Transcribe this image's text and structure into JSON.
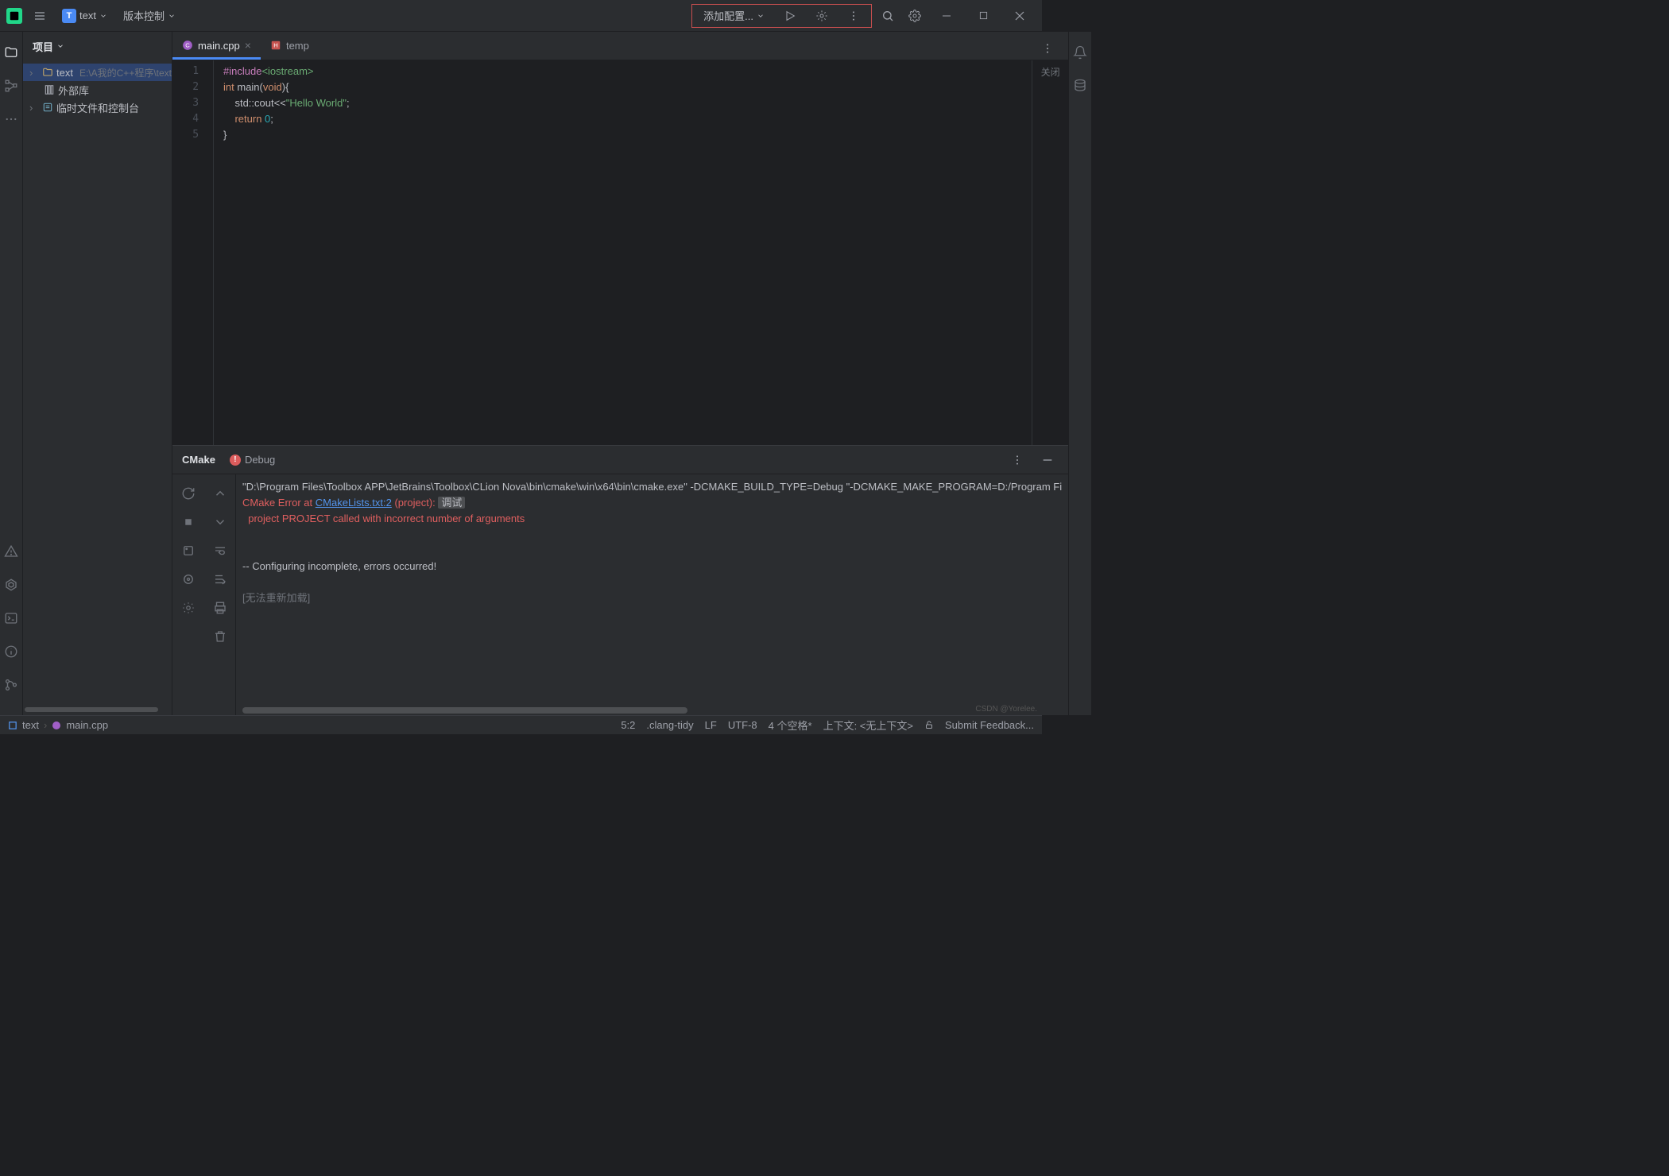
{
  "titlebar": {
    "project_badge": "T",
    "project_name": "text",
    "vcs_label": "版本控制",
    "run_config": "添加配置..."
  },
  "project_panel": {
    "title": "项目",
    "items": [
      {
        "label": "text",
        "path": "E:\\A我的C++程序\\text",
        "icon": "folder",
        "sel": true
      },
      {
        "label": "外部库",
        "icon": "lib",
        "sel": false
      },
      {
        "label": "临时文件和控制台",
        "icon": "scratch",
        "sel": false
      }
    ]
  },
  "tabs": [
    {
      "label": "main.cpp",
      "icon": "cpp",
      "active": true,
      "closable": true
    },
    {
      "label": "temp",
      "icon": "h",
      "active": false,
      "closable": false
    }
  ],
  "editor": {
    "close_label": "关闭",
    "lines": [
      {
        "n": 1,
        "tokens": [
          [
            "#include",
            "pp"
          ],
          [
            "<iostream>",
            "inc"
          ]
        ]
      },
      {
        "n": 2,
        "tokens": [
          [
            "int ",
            "kw"
          ],
          [
            "main",
            "fn"
          ],
          [
            "(",
            "pn"
          ],
          [
            "void",
            "kw"
          ],
          [
            "){",
            "pn"
          ]
        ]
      },
      {
        "n": 3,
        "tokens": [
          [
            "    std::",
            "id"
          ],
          [
            "cout",
            "id"
          ],
          [
            "<<",
            "pn"
          ],
          [
            "\"Hello World\"",
            "str"
          ],
          [
            ";",
            "pn"
          ]
        ]
      },
      {
        "n": 4,
        "tokens": [
          [
            "    ",
            "id"
          ],
          [
            "return ",
            "kw"
          ],
          [
            "0",
            "num"
          ],
          [
            ";",
            "pn"
          ]
        ]
      },
      {
        "n": 5,
        "tokens": [
          [
            "}",
            "pn"
          ]
        ]
      }
    ]
  },
  "bottom": {
    "tabs": {
      "cmake": "CMake",
      "debug": "Debug"
    },
    "console": {
      "cmd": "\"D:\\Program Files\\Toolbox APP\\JetBrains\\Toolbox\\CLion Nova\\bin\\cmake\\win\\x64\\bin\\cmake.exe\" -DCMAKE_BUILD_TYPE=Debug \"-DCMAKE_MAKE_PROGRAM=D:/Program Fi",
      "err_prefix": "CMake Error at ",
      "err_link": "CMakeLists.txt:2",
      "err_suffix": " (project):",
      "err_tag": "调试",
      "err_detail": "  project PROJECT called with incorrect number of arguments",
      "info": "-- Configuring incomplete, errors occurred!",
      "reload": "[无法重新加载]"
    }
  },
  "statusbar": {
    "module": "text",
    "file": "main.cpp",
    "pos": "5:2",
    "tidy": ".clang-tidy",
    "lf": "LF",
    "enc": "UTF-8",
    "indent": "4 个空格*",
    "ctx": "上下文: <无上下文>",
    "feedback": "Submit Feedback..."
  },
  "watermark": "CSDN @Yorelee."
}
